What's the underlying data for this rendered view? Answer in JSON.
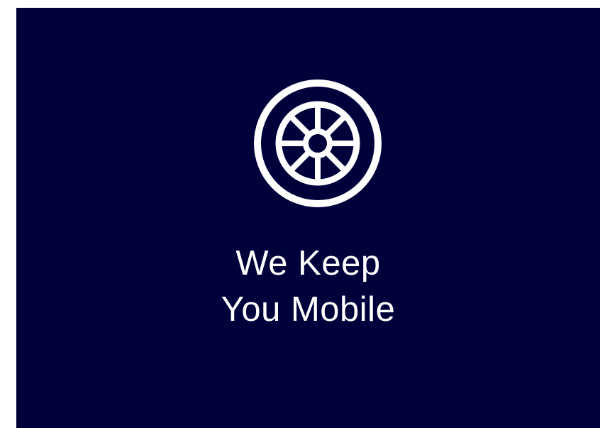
{
  "colors": {
    "background": "#00003a",
    "foreground": "#ffffff",
    "outer_margin": "#ffffff"
  },
  "icon": {
    "name": "wheel-icon"
  },
  "tagline": {
    "line1": "We Keep",
    "line2": "You Mobile"
  }
}
